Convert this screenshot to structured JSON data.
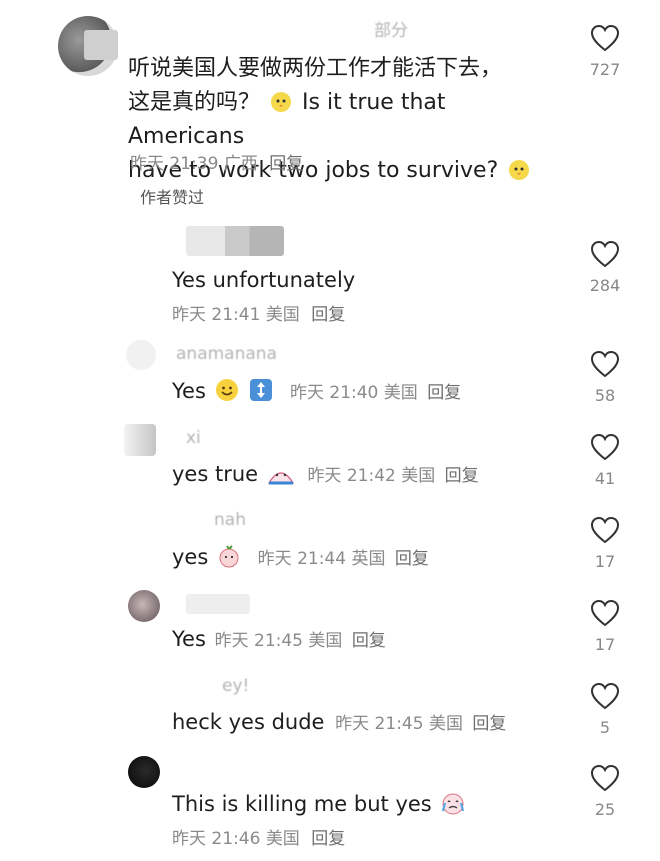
{
  "main_comment": {
    "username": "部分",
    "text_line1": "听说美国人要做两份工作才能活下去，",
    "text_line2_cn": "这是真的吗？",
    "text_line2_en": "Is it true that Americans",
    "text_line3": "have to work two jobs to survive?",
    "time": "昨天 21:39",
    "location": "广西",
    "reply": "回复",
    "likes": "727",
    "liked_by_author": "作者赞过"
  },
  "replies": [
    {
      "username": "",
      "text": "Yes unfortunately",
      "time": "昨天 21:41",
      "location": "美国",
      "reply": "回复",
      "likes": "284"
    },
    {
      "username": "anamanana",
      "text": "Yes",
      "time": "昨天 21:40",
      "location": "美国",
      "reply": "回复",
      "likes": "58"
    },
    {
      "username": "xi",
      "text": "yes true",
      "time": "昨天 21:42",
      "location": "美国",
      "reply": "回复",
      "likes": "41"
    },
    {
      "username": "nah",
      "text": "yes",
      "time": "昨天 21:44",
      "location": "英国",
      "reply": "回复",
      "likes": "17"
    },
    {
      "username": "",
      "text": "Yes",
      "time": "昨天 21:45",
      "location": "美国",
      "reply": "回复",
      "likes": "17"
    },
    {
      "username": "ey!",
      "text": "heck yes dude",
      "time": "昨天 21:45",
      "location": "美国",
      "reply": "回复",
      "likes": "5"
    },
    {
      "username": "",
      "text": "This is killing me but yes",
      "time": "昨天 21:46",
      "location": "美国",
      "reply": "回复",
      "likes": "25"
    }
  ],
  "icons": {
    "like": "heart-outline-icon"
  },
  "colors": {
    "text": "#1e1e1e",
    "meta": "#8a8a8a",
    "icon": "#333333"
  }
}
